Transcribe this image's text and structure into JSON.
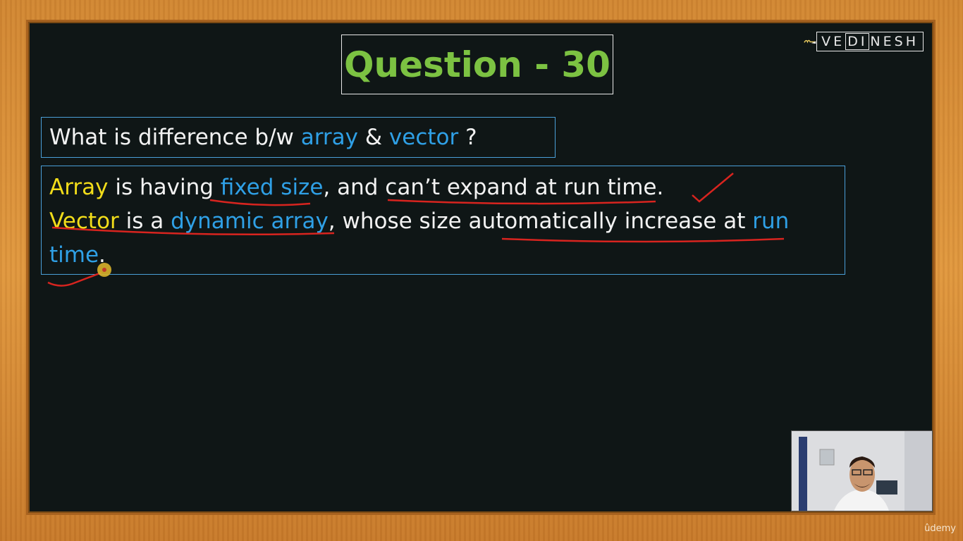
{
  "logo": {
    "text_prefix": "VE",
    "text_boxed": "DI",
    "text_suffix": "NESH",
    "icon": "brush-stroke-logo-mark"
  },
  "title": "Question - 30",
  "question": {
    "prefix": "What is difference b/w ",
    "term1": "array",
    "joiner": " & ",
    "term2": "vector",
    "suffix": " ?"
  },
  "answer": {
    "line1": {
      "t1": "Array",
      "t2": " is having ",
      "t3": "fixed size",
      "t4": ", and can’t expand at run time."
    },
    "line2": {
      "t1": "Vector",
      "t2": " is a ",
      "t3": "dynamic array",
      "t4": ", whose size automatically increase at ",
      "t5": "run"
    },
    "line3": {
      "t1": "time",
      "t2": "."
    }
  },
  "watermark": "ûdemy",
  "colors": {
    "title_green": "#7cc242",
    "term_blue": "#2fa0e6",
    "term_yellow": "#f2dd1a",
    "annotation_red": "#d8241f",
    "box_border": "#4a9fd8",
    "board": "#0f1616",
    "frame_wood": "#d18733"
  }
}
